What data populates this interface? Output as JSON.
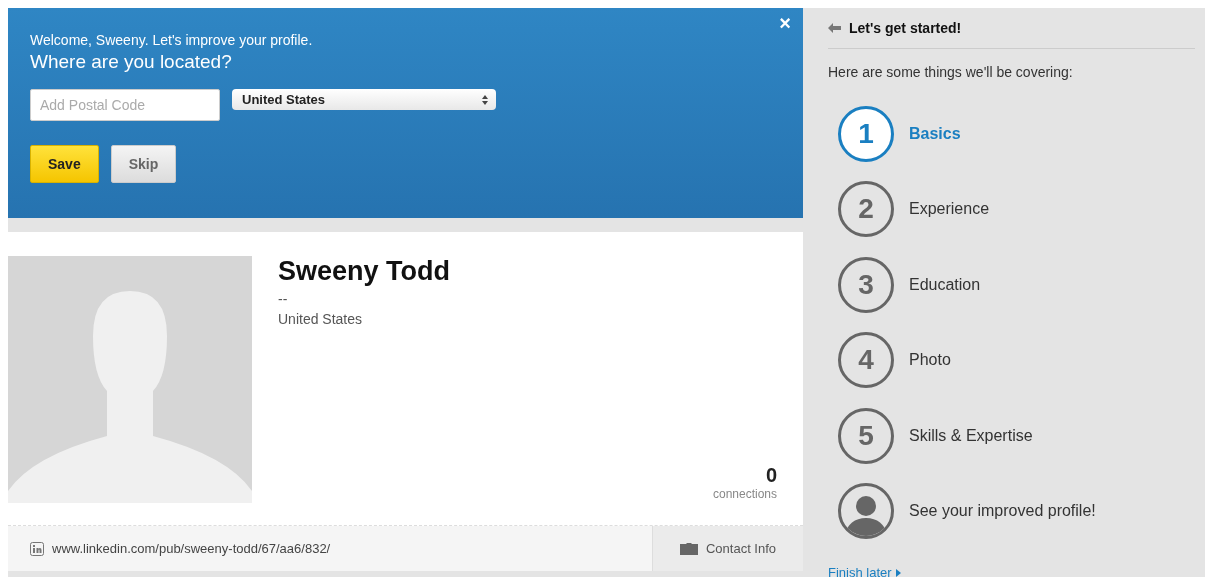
{
  "welcome_panel": {
    "greeting": "Welcome, Sweeny. Let's improve your profile.",
    "question": "Where are you located?",
    "close": "×",
    "postal_code": {
      "placeholder": "Add Postal Code"
    },
    "country": {
      "value": "United States"
    },
    "buttons": [
      {
        "label": "Save",
        "kind": "primary"
      },
      {
        "label": "Skip",
        "kind": "secondary"
      }
    ]
  },
  "profile": {
    "name": "Sweeny Todd",
    "headline": "--",
    "location": "United States",
    "connections_count": "0",
    "connections_label": "connections",
    "url": "www.linkedin.com/pub/sweeny-todd/67/aa6/832/",
    "contact": "Contact Info"
  },
  "sidebar": {
    "title": "Let's get started!",
    "intro": "Here are some things we'll be covering:",
    "steps": [
      {
        "kind": "number",
        "number": "1",
        "label": "Basics",
        "selected": true
      },
      {
        "kind": "number",
        "number": "2",
        "label": "Experience",
        "selected": false
      },
      {
        "kind": "number",
        "number": "3",
        "label": "Education",
        "selected": false
      },
      {
        "kind": "number",
        "number": "4",
        "label": "Photo",
        "selected": false
      },
      {
        "kind": "number",
        "number": "5",
        "label": "Skills & Expertise",
        "selected": false
      },
      {
        "kind": "avatar",
        "label": "See your improved profile!",
        "selected": false
      }
    ],
    "finish_link": "Finish later"
  }
}
